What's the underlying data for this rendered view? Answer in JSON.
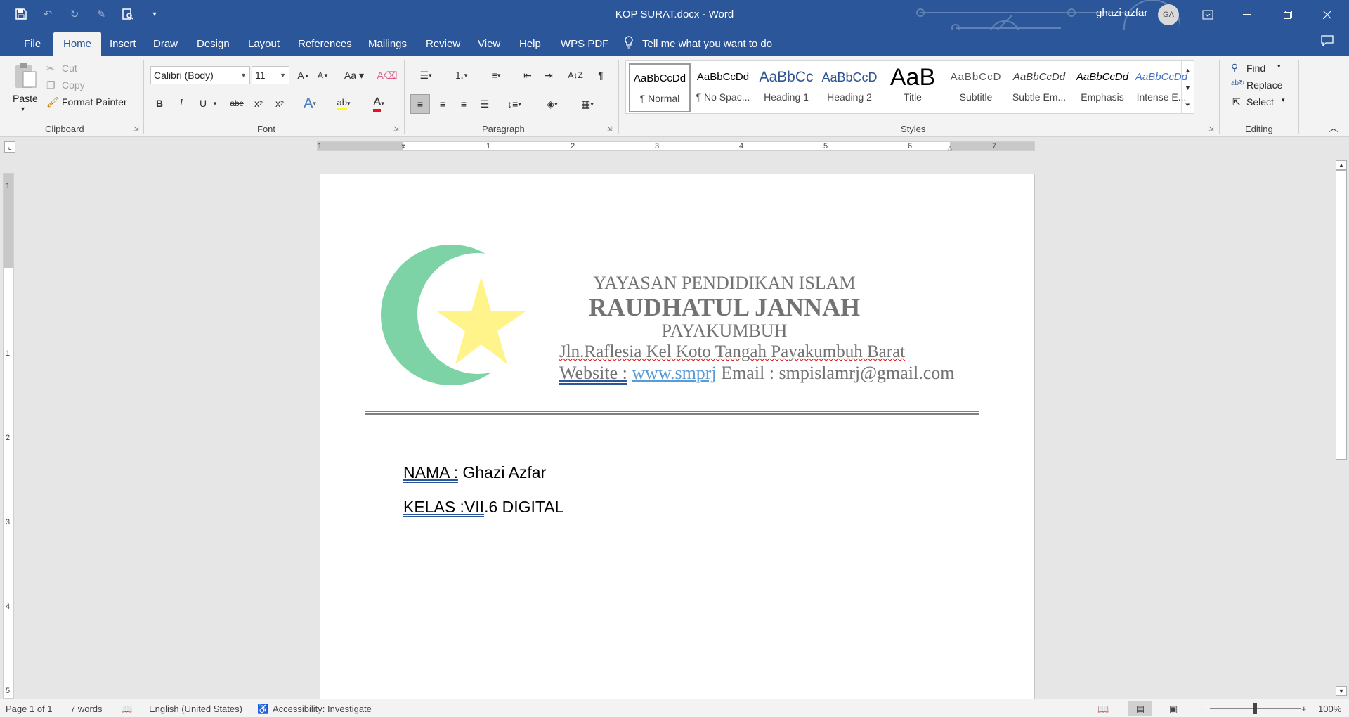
{
  "window": {
    "title": "KOP SURAT.docx  -  Word",
    "user": "ghazi azfar",
    "avatar_initials": "GA"
  },
  "tabs": [
    "File",
    "Home",
    "Insert",
    "Draw",
    "Design",
    "Layout",
    "References",
    "Mailings",
    "Review",
    "View",
    "Help",
    "WPS PDF"
  ],
  "tell_me": "Tell me what you want to do",
  "clipboard": {
    "paste": "Paste",
    "cut": "Cut",
    "copy": "Copy",
    "format_painter": "Format Painter",
    "label": "Clipboard"
  },
  "font": {
    "name": "Calibri (Body)",
    "size": "11",
    "label": "Font",
    "accent_color": "#e81123",
    "highlight_color": "#ffff00"
  },
  "paragraph": {
    "label": "Paragraph"
  },
  "styles": {
    "label": "Styles",
    "items": [
      {
        "preview": "AaBbCcDd",
        "name": "¶ Normal"
      },
      {
        "preview": "AaBbCcDd",
        "name": "¶ No Spac..."
      },
      {
        "preview": "AaBbCc",
        "name": "Heading 1"
      },
      {
        "preview": "AaBbCcD",
        "name": "Heading 2"
      },
      {
        "preview": "AaB",
        "name": "Title"
      },
      {
        "preview": "AaBbCcD",
        "name": "Subtitle"
      },
      {
        "preview": "AaBbCcDd",
        "name": "Subtle Em..."
      },
      {
        "preview": "AaBbCcDd",
        "name": "Emphasis"
      },
      {
        "preview": "AaBbCcDd",
        "name": "Intense E..."
      }
    ]
  },
  "editing": {
    "find": "Find",
    "replace": "Replace",
    "select": "Select",
    "label": "Editing"
  },
  "ruler": {
    "h_numbers": [
      "1",
      "1",
      "2",
      "3",
      "4",
      "5",
      "6",
      "7"
    ],
    "v_numbers": [
      "1",
      "1",
      "2",
      "3",
      "4",
      "5"
    ]
  },
  "document": {
    "kop": {
      "line1": "YAYASAN PENDIDIKAN ISLAM",
      "line2": "RAUDHATUL JANNAH",
      "line3": "PAYAKUMBUH",
      "line4": "Jln.Raflesia Kel Koto Tangah Payakumbuh Barat",
      "website_label": "Website :",
      "website_url": "www.smprj",
      "email": " Email : smpislamrj@gmail.com",
      "logo_crescent_color": "#7dd3a5",
      "logo_star_color": "#fff48a"
    },
    "nama_label": "NAMA :",
    "nama_value": " Ghazi Azfar",
    "kelas_label": "KELAS :VII",
    "kelas_value": ".6 DIGITAL"
  },
  "status": {
    "page": "Page 1 of 1",
    "words": "7 words",
    "language": "English (United States)",
    "accessibility": "Accessibility: Investigate",
    "zoom": "100%"
  }
}
